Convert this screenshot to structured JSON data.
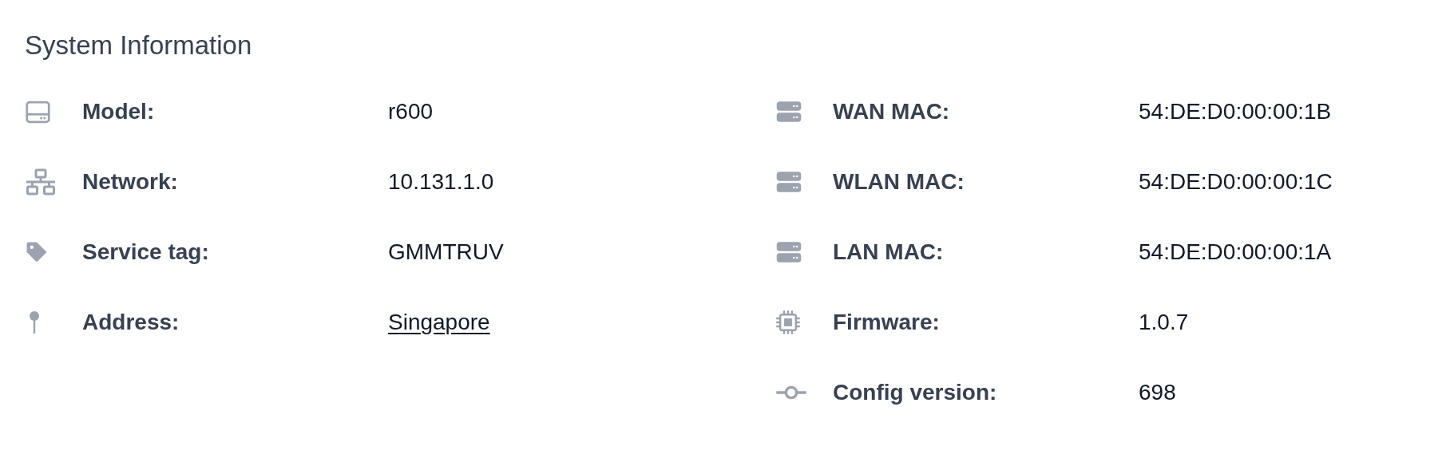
{
  "title": "System Information",
  "columns": [
    [
      {
        "label": "Model:",
        "value": "r600",
        "kind": "text"
      },
      {
        "label": "Network:",
        "value": "10.131.1.0",
        "kind": "text"
      },
      {
        "label": "Service tag:",
        "value": "GMMTRUV",
        "kind": "text"
      },
      {
        "label": "Address:",
        "value": "Singapore",
        "kind": "link"
      }
    ],
    [
      {
        "label": "WAN MAC:",
        "value": "54:DE:D0:00:00:1B",
        "kind": "text"
      },
      {
        "label": "WLAN MAC:",
        "value": "54:DE:D0:00:00:1C",
        "kind": "text"
      },
      {
        "label": "LAN MAC:",
        "value": "54:DE:D0:00:00:1A",
        "kind": "text"
      },
      {
        "label": "Firmware:",
        "value": "1.0.7",
        "kind": "text"
      },
      {
        "label": "Config version:",
        "value": "698",
        "kind": "text"
      }
    ]
  ]
}
